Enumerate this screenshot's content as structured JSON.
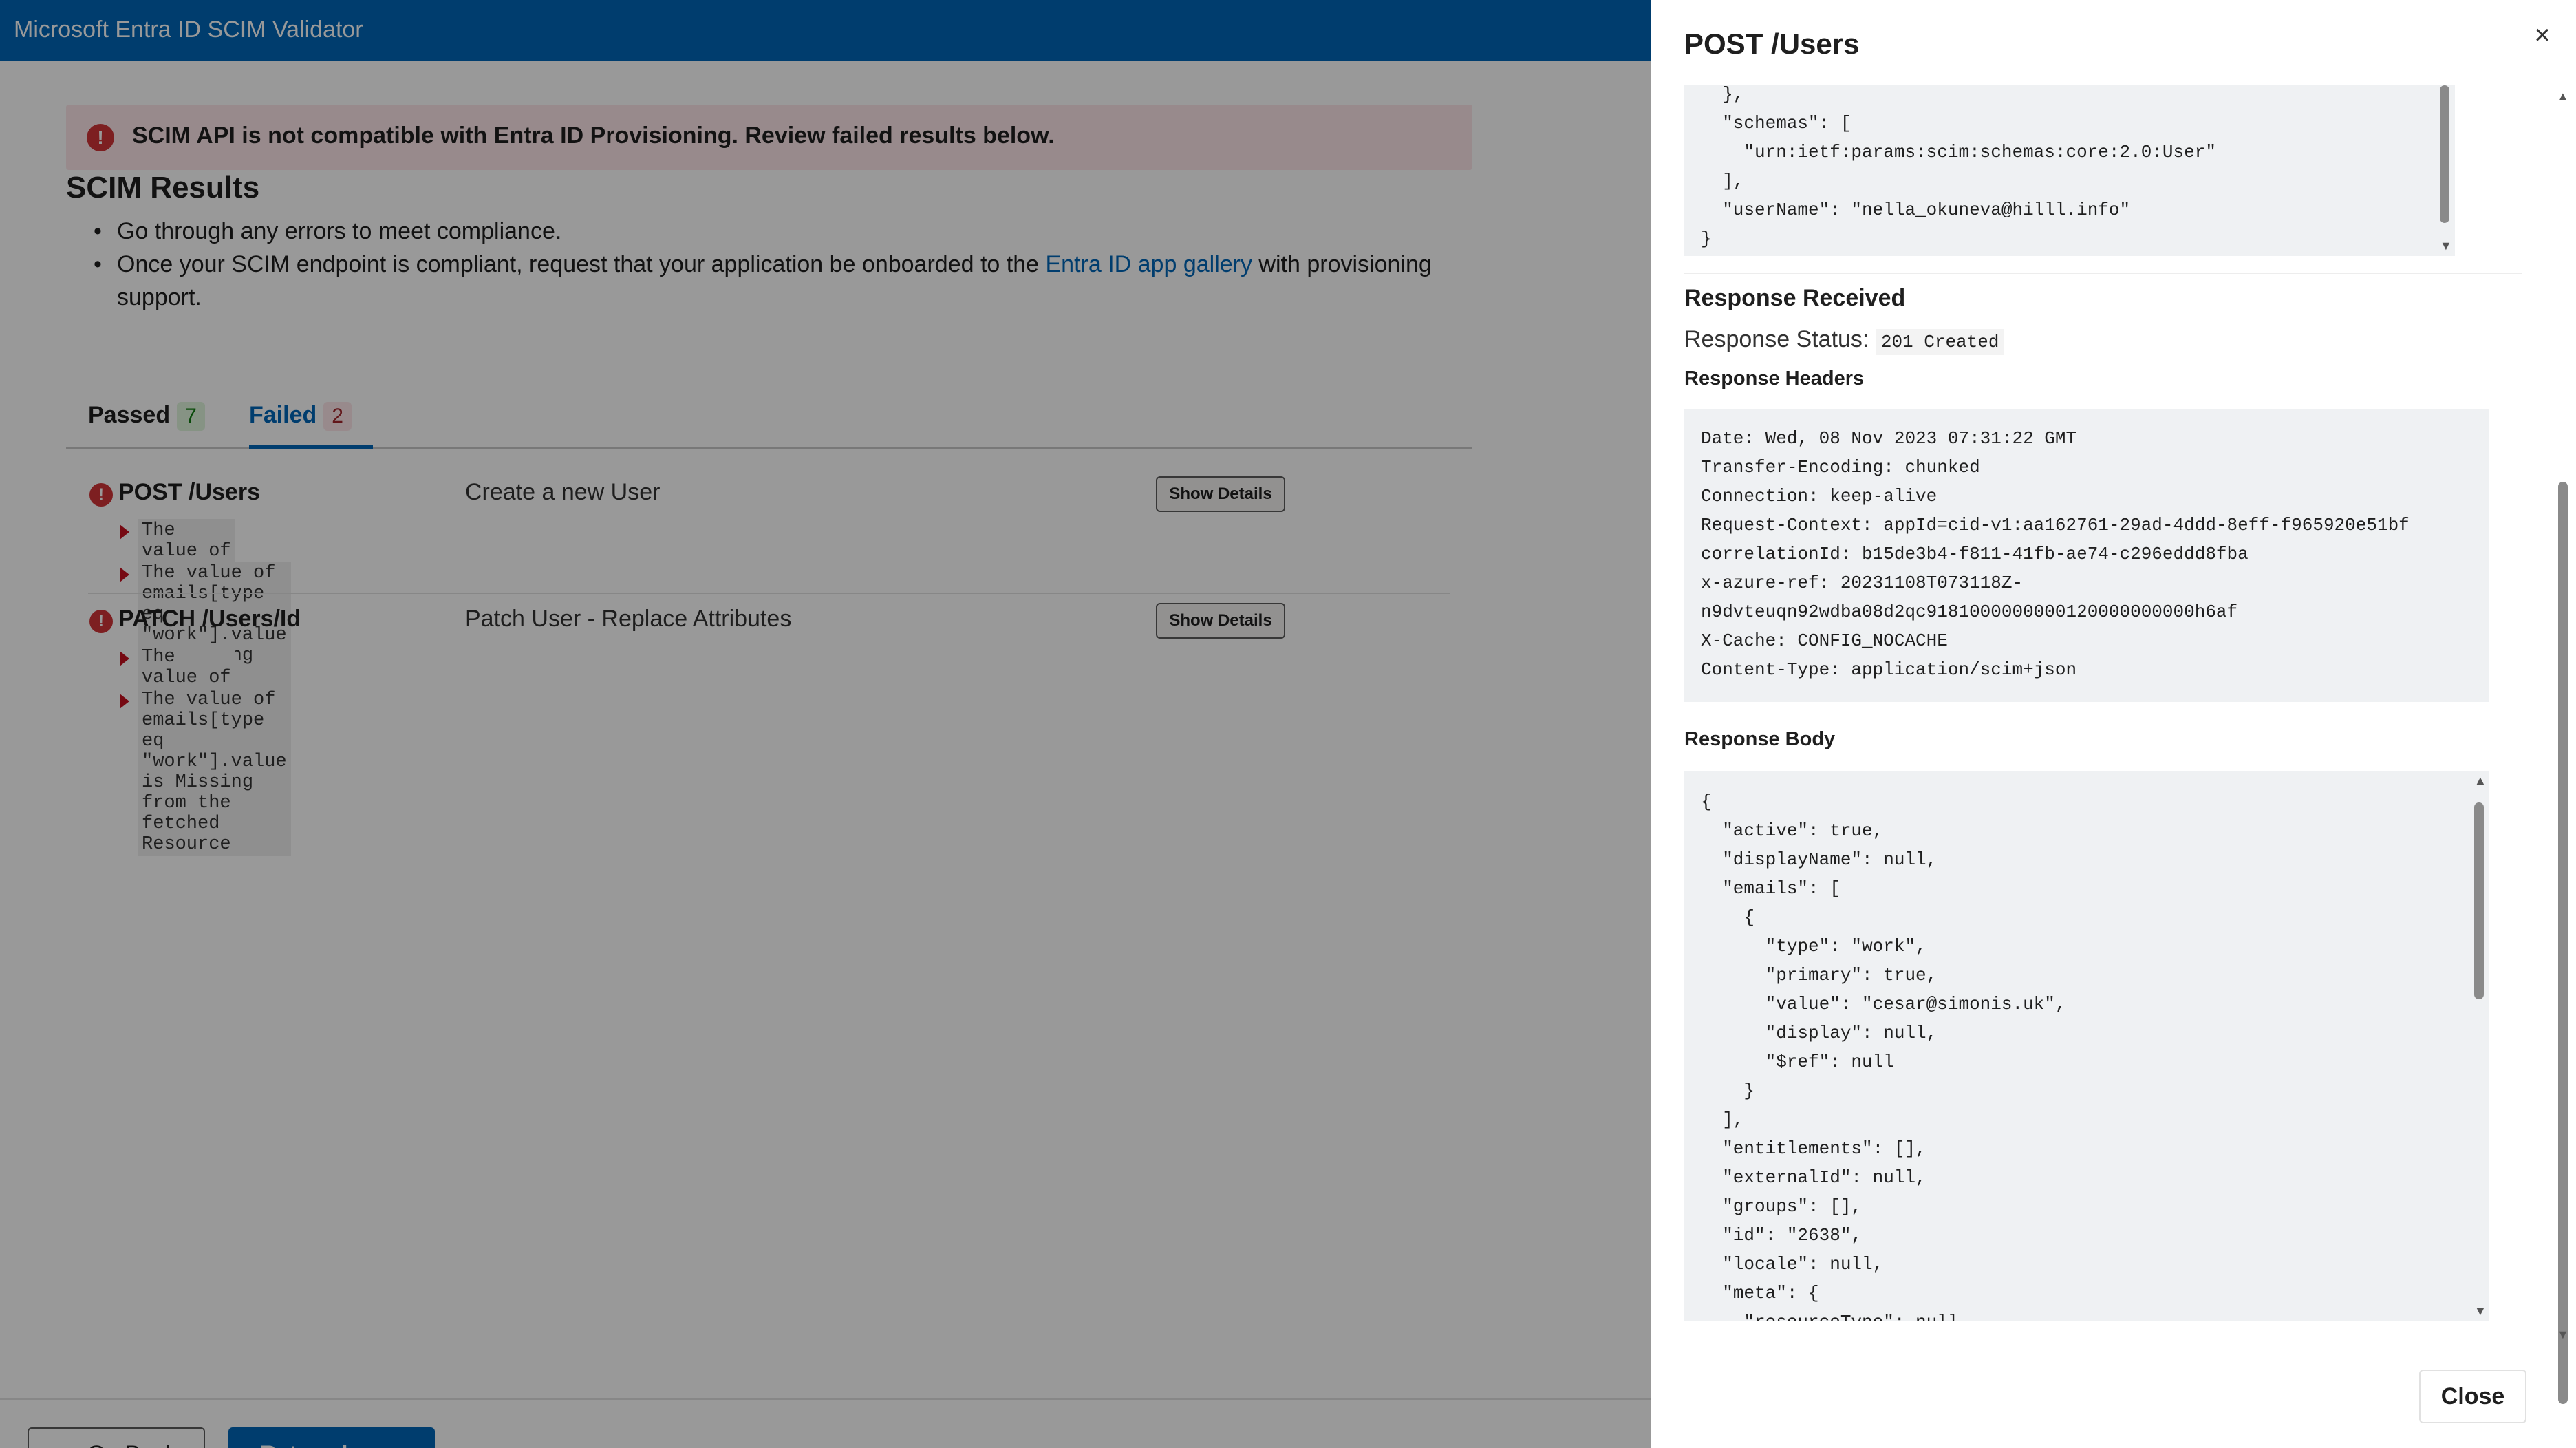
{
  "app": {
    "title": "Microsoft Entra ID SCIM Validator"
  },
  "alert": {
    "text": "SCIM API is not compatible with Entra ID Provisioning. Review failed results below.",
    "icon": "error-icon"
  },
  "results": {
    "title": "SCIM Results",
    "bullet1": "Go through any errors to meet compliance.",
    "bullet2_before": "Once your SCIM endpoint is compliant, request that your application be onboarded to the ",
    "bullet2_link": "Entra ID app gallery",
    "bullet2_after": " with provisioning support."
  },
  "tabs": {
    "passed_label": "Passed",
    "passed_count": "7",
    "failed_label": "Failed",
    "failed_count": "2"
  },
  "failed_items": [
    {
      "method": "POST /Users",
      "description": "Create a new User",
      "button": "Show Details",
      "details": [
        "The value of active is Missing from the fetched Resource",
        "The value of emails[type eq \"work\"].value is Missing from the fetched Resource"
      ]
    },
    {
      "method": "PATCH /Users/Id",
      "description": "Patch User - Replace Attributes",
      "button": "Show Details",
      "details": [
        "The value of active is Missing from the fetched Resource",
        "The value of emails[type eq \"work\"].value is Missing from the fetched Resource"
      ]
    }
  ],
  "footer": {
    "back_label": "Go Back",
    "home_label": "Return home"
  },
  "panel": {
    "title": "POST /Users",
    "request_body_visible": "  },\n  \"schemas\": [\n    \"urn:ietf:params:scim:schemas:core:2.0:User\"\n  ],\n  \"userName\": \"nella_okuneva@hilll.info\"\n}",
    "response_received": "Response Received",
    "status_label": "Response Status:",
    "status_value": "201 Created",
    "headers_title": "Response Headers",
    "headers_text": "Date: Wed, 08 Nov 2023 07:31:22 GMT\nTransfer-Encoding: chunked\nConnection: keep-alive\nRequest-Context: appId=cid-v1:aa162761-29ad-4ddd-8eff-f965920e51bf\ncorrelationId: b15de3b4-f811-41fb-ae74-c296eddd8fba\nx-azure-ref: 20231108T073118Z-\nn9dvteuqn92wdba08d2qc9181000000000120000000000h6af\nX-Cache: CONFIG_NOCACHE\nContent-Type: application/scim+json",
    "body_title": "Response Body",
    "body_text": "{\n  \"active\": true,\n  \"displayName\": null,\n  \"emails\": [\n    {\n      \"type\": \"work\",\n      \"primary\": true,\n      \"value\": \"cesar@simonis.uk\",\n      \"display\": null,\n      \"$ref\": null\n    }\n  ],\n  \"entitlements\": [],\n  \"externalId\": null,\n  \"groups\": [],\n  \"id\": \"2638\",\n  \"locale\": null,\n  \"meta\": {\n    \"resourceType\": null",
    "close_label": "Close",
    "close_icon": "×"
  },
  "colors": {
    "brand": "#0067b8",
    "error": "#d13438",
    "alert_bg": "#fde7e9"
  }
}
